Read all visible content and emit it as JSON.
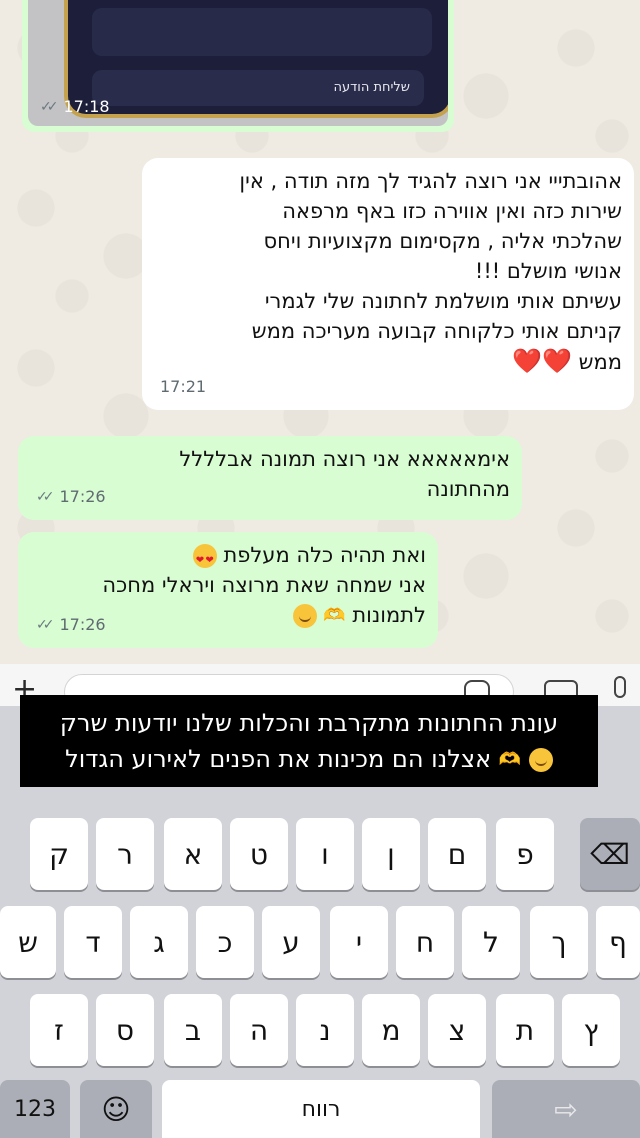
{
  "image_message": {
    "inner_label": "שליחת הודעה",
    "time": "17:18"
  },
  "messages": [
    {
      "id": "incoming-1",
      "lines": [
        "אהובתייי אני רוצה להגיד לך מזה תודה , אין",
        "שירות כזה ואין אווירה כזו באף מרפאה",
        "שהלכתי אליה , מקסימום מקצועיות ויחס",
        "אנושי מושלם !!!",
        "עשיתם אותי מושלמת לחתונה שלי לגמרי",
        "קניתם אותי כלקוחה קבועה מעריכה ממש",
        "ממש"
      ],
      "emoji": "❤️❤️",
      "time": "17:21"
    },
    {
      "id": "outgoing-1",
      "lines": [
        "אימאאאאא אני רוצה תמונה אבלללל",
        "מהחתונה"
      ],
      "time": "17:26"
    },
    {
      "id": "outgoing-2",
      "lines": [
        "ואת תהיה כלה מעלפת",
        "אני שמחה שאת מרוצה ויראלי מחכה",
        "לתמונות"
      ],
      "time": "17:26"
    }
  ],
  "caption": {
    "line1": "עונת החתונות מתקרבת והכלות שלנו יודעות שרק",
    "line2": "אצלנו הם מכינות את הפנים לאירוע הגדול"
  },
  "keyboard": {
    "row1": [
      "פ",
      "ם",
      "ן",
      "ו",
      "ט",
      "א",
      "ר",
      "ק"
    ],
    "row2": [
      "ף",
      "ך",
      "ל",
      "ח",
      "י",
      "ע",
      "כ",
      "ג",
      "ד",
      "ש"
    ],
    "row3": [
      "ץ",
      "ת",
      "צ",
      "מ",
      "נ",
      "ה",
      "ב",
      "ס",
      "ז"
    ],
    "numbers_label": "123",
    "space_label": "רווח"
  },
  "colors": {
    "outgoing_bubble": "#d9fdd3",
    "incoming_bubble": "#ffffff",
    "chat_background": "#efeae2",
    "keyboard_background": "#d2d3d8"
  }
}
